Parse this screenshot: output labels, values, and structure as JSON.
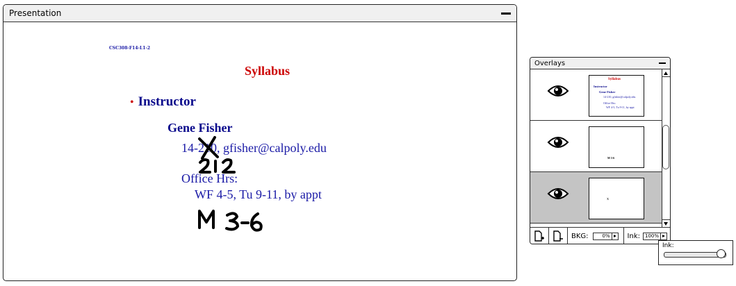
{
  "presentation": {
    "title": "Presentation",
    "slide": {
      "code": "CSC308-F14-L1-2",
      "title": "Syllabus",
      "bullet": "Instructor",
      "name": "Gene Fisher",
      "office_prefix": "14-2",
      "office_struck": "10",
      "office_suffix": ", gfisher@calpoly.edu",
      "hours_label": "Office Hrs:",
      "hours": "WF 4-5, Tu 9-11, by appt",
      "ink_correction": "212",
      "ink_added_hours": "M 3-6"
    }
  },
  "overlays": {
    "title": "Overlays",
    "rows": [
      {
        "selected": false,
        "thumb": {
          "title": "Syllabus",
          "bullet": "Instructor",
          "name": "Gene Fisher",
          "office": "14-210, gfisher@calpoly.edu",
          "hours_label": "Office Hrs:",
          "hours": "WF 4-5, Tu 9-11, by appt"
        }
      },
      {
        "selected": false,
        "thumb": {
          "ink": "M 3-6"
        }
      },
      {
        "selected": true,
        "thumb": {
          "ink": "x"
        }
      }
    ],
    "toolbar": {
      "bkg_label": "BKG:",
      "bkg_value": "0%",
      "ink_label": "Ink:",
      "ink_value": "100%"
    }
  },
  "ink_popup": {
    "label": "Ink:",
    "level": 1.0
  },
  "colors": {
    "slide_title": "#cc0000",
    "slide_text": "#1a1aa6",
    "selected_row": "#c4c4c4"
  }
}
